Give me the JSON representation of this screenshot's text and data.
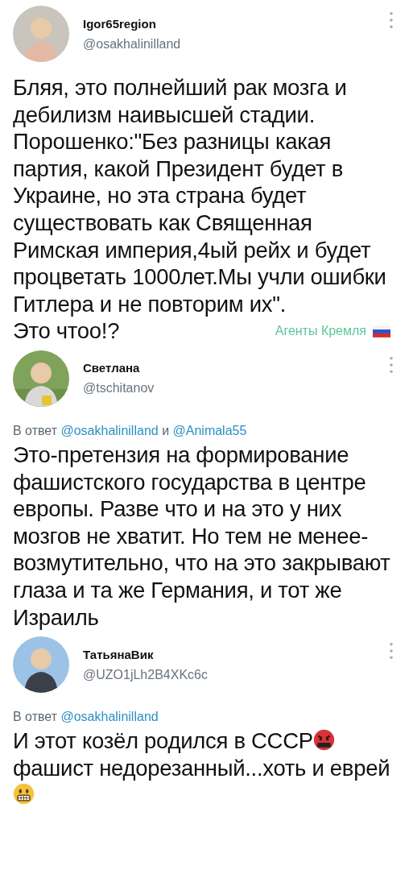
{
  "tweets": [
    {
      "name": "Igor65region",
      "handle": "@osakhalinilland",
      "body": [
        {
          "kind": "text",
          "text": "Бляя, это полнейший рак мозга и дебилизм наивысшей стадии. Порошенко:\"Без разницы какая партия, какой Президент будет в Украине, но эта страна будет существовать как Священная Римская империя,4ый рейх и будет процветать 1000лет.Мы учли ошибки Гитлера и не повторим их\"."
        }
      ],
      "tail": "Это чтоо!?",
      "tag": "Агенты Кремля"
    },
    {
      "name": "Светлана",
      "handle": "@tschitanov",
      "reply": [
        {
          "kind": "text",
          "text": "В ответ"
        },
        {
          "kind": "mention",
          "text": "@osakhalinilland"
        },
        {
          "kind": "text",
          "text": "и"
        },
        {
          "kind": "mention",
          "text": "@Animala55"
        }
      ],
      "body": [
        {
          "kind": "text",
          "text": "Это-претензия на формирование фашистского государства в центре европы. Разве что и на это у них мозгов не хватит. Но тем не менее-возмутительно, что на это закрывают глаза и та же Германия, и тот же Израиль"
        }
      ]
    },
    {
      "name": "ТатьянаВик",
      "handle": "@UZO1jLh2B4XKc6c",
      "reply": [
        {
          "kind": "text",
          "text": "В ответ"
        },
        {
          "kind": "mention",
          "text": "@osakhalinilland"
        }
      ],
      "body": [
        {
          "kind": "text",
          "text": "И этот козёл родился в СССР"
        },
        {
          "kind": "angry"
        },
        {
          "kind": "text",
          "text": " фашист недорезанный...хоть и еврей"
        },
        {
          "kind": "grimace"
        }
      ]
    }
  ]
}
